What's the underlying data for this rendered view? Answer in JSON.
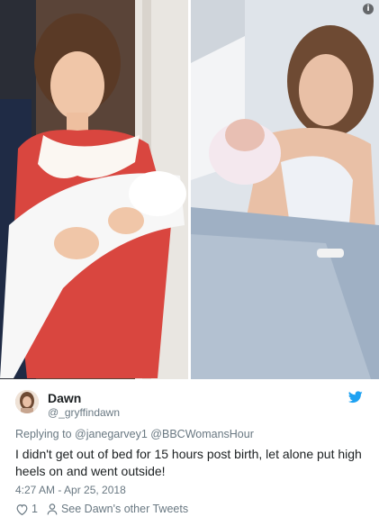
{
  "tweet": {
    "display_name": "Dawn",
    "handle": "@_gryffindawn",
    "replying_prefix": "Replying to",
    "replying_to": "@janegarvey1 @BBCWomansHour",
    "text": "I didn't get out of bed for 15 hours post birth, let alone put high heels on and went outside!",
    "timestamp": "4:27 AM - Apr 25, 2018",
    "like_count": "1",
    "other_tweets_label": "See Dawn's other Tweets"
  },
  "icons": {
    "info": "info-icon",
    "bird": "twitter-bird-icon",
    "heart": "heart-icon",
    "person": "person-icon"
  },
  "colors": {
    "twitter_blue": "#1da1f2",
    "dress_red": "#d9463f",
    "text_secondary": "#697882"
  }
}
